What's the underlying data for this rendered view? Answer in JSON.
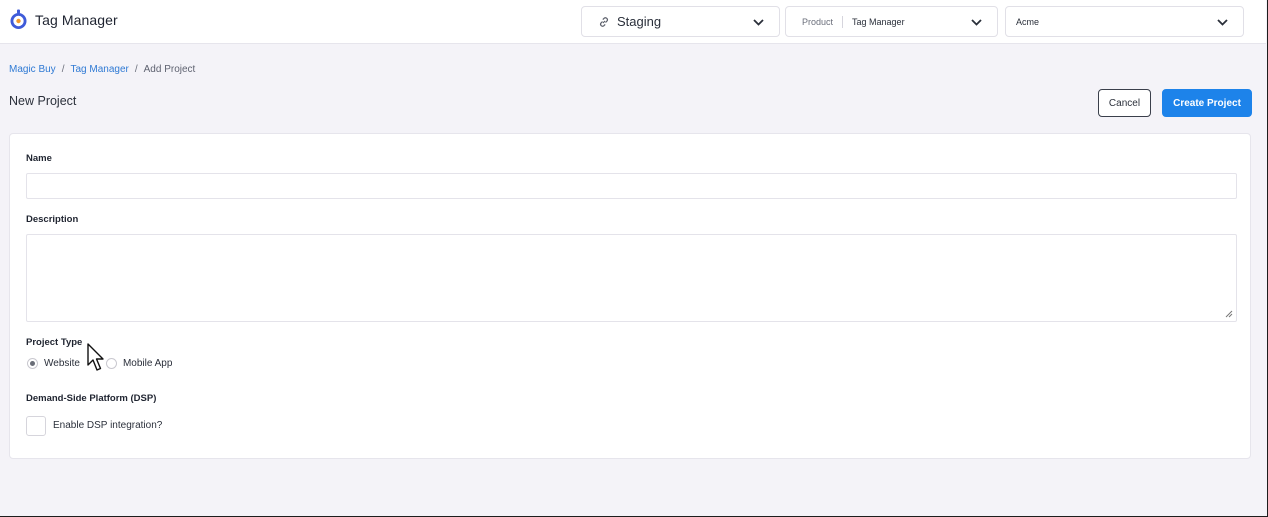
{
  "app": {
    "title": "Tag Manager",
    "logo_icon": "tag-manager-logo-icon"
  },
  "header": {
    "environment": {
      "icon": "link-icon",
      "value": "Staging"
    },
    "product": {
      "label": "Product",
      "value": "Tag Manager"
    },
    "organization": {
      "value": "Acme"
    }
  },
  "breadcrumb": {
    "items": [
      "Magic Buy",
      "Tag Manager",
      "Add Project"
    ],
    "separator": "/"
  },
  "page": {
    "title": "New Project"
  },
  "actions": {
    "cancel_label": "Cancel",
    "create_label": "Create Project"
  },
  "form": {
    "name": {
      "label": "Name",
      "value": ""
    },
    "description": {
      "label": "Description",
      "value": ""
    },
    "project_type": {
      "label": "Project Type",
      "options": [
        "Website",
        "Mobile App"
      ],
      "selected": "Website"
    },
    "dsp": {
      "label": "Demand-Side Platform (DSP)",
      "checkbox_label": "Enable DSP integration?",
      "checked": false
    }
  },
  "colors": {
    "primary": "#1d83ea",
    "link": "#2f7ad4",
    "background": "#f4f3f8"
  }
}
